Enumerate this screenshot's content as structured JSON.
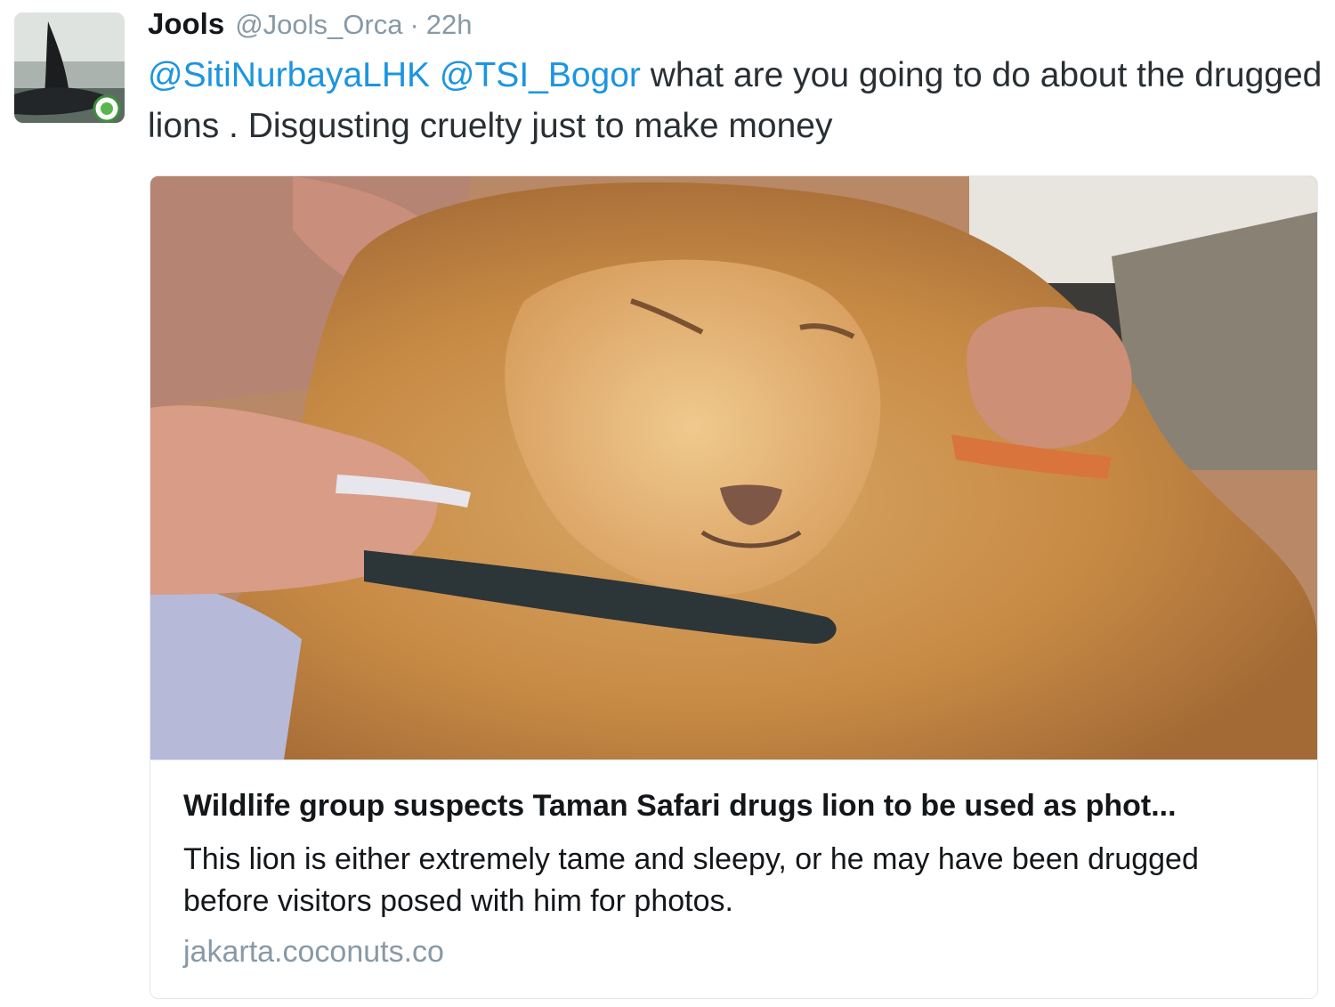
{
  "tweet": {
    "author": {
      "display_name": "Jools",
      "handle": "@Jools_Orca",
      "avatar_icon": "orca-avatar-icon"
    },
    "separator": "·",
    "time": "22h",
    "text": {
      "mention_1": "@SitiNurbayaLHK",
      "mention_2": "@TSI_Bogor",
      "body": " what are you going to do about the drugged lions . Disgusting cruelty just to make money"
    },
    "colors": {
      "link": "#1b95e0",
      "text": "#292f33",
      "secondary": "#8899a6"
    }
  },
  "card": {
    "image_icon": "sedated-lion-photo",
    "title": "Wildlife group suspects Taman Safari drugs lion to be used as phot...",
    "description": "This lion is either extremely tame and sleepy, or he may have been drugged before visitors posed with him for photos.",
    "domain": "jakarta.coconuts.co"
  }
}
